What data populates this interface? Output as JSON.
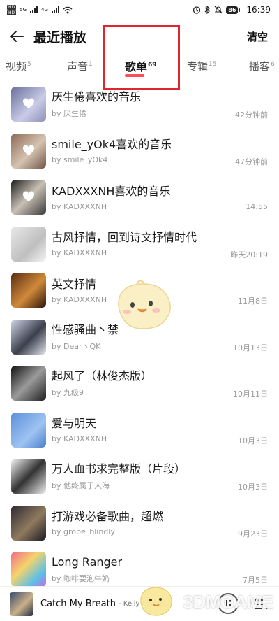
{
  "status_bar": {
    "sim1": "HD",
    "sim2": "HD",
    "net1": "5G",
    "net2": "4G",
    "battery": "86",
    "time": "16:39"
  },
  "header": {
    "title": "最近播放",
    "clear_label": "清空"
  },
  "tabs": [
    {
      "label": "视频",
      "count": "5"
    },
    {
      "label": "声音",
      "count": "1"
    },
    {
      "label": "歌单",
      "count": "69",
      "active": true
    },
    {
      "label": "专辑",
      "count": "15"
    },
    {
      "label": "播客",
      "count": "6"
    }
  ],
  "playlists": [
    {
      "title": "厌生倦喜欢的音乐",
      "creator": "by 厌生倦",
      "time": "42分钟前"
    },
    {
      "title": "smile_yOk4喜欢的音乐",
      "creator": "by smile_yOk4",
      "time": "47分钟前"
    },
    {
      "title": "KADXXXNH喜欢的音乐",
      "creator": "by KADXXXNH",
      "time": "14:55"
    },
    {
      "title": "古风抒情，回到诗文抒情时代",
      "creator": "by KADXXXNH",
      "time": "昨天20:19"
    },
    {
      "title": "英文抒情",
      "creator": "by KADXXXNH",
      "time": "11月8日"
    },
    {
      "title": "性感骚曲丶禁",
      "creator": "by Dear丶QK",
      "time": "10月13日"
    },
    {
      "title": "起风了（林俊杰版）",
      "creator": "by 九级9",
      "time": "10月11日"
    },
    {
      "title": "爱与明天",
      "creator": "by KADXXXNH",
      "time": "10月3日"
    },
    {
      "title": "万人血书求完整版（片段）",
      "creator": "by 他终属于人海",
      "time": "10月3日"
    },
    {
      "title": "打游戏必备歌曲，超燃",
      "creator": "by grope_blindly",
      "time": "9月23日"
    },
    {
      "title": "Long Ranger",
      "creator": "by 咖啡要泡牛奶",
      "time": "7月5日"
    }
  ],
  "player": {
    "title": "Catch My Breath",
    "artist": "- Kelly Clarkson"
  },
  "watermark": "3DMGAME"
}
